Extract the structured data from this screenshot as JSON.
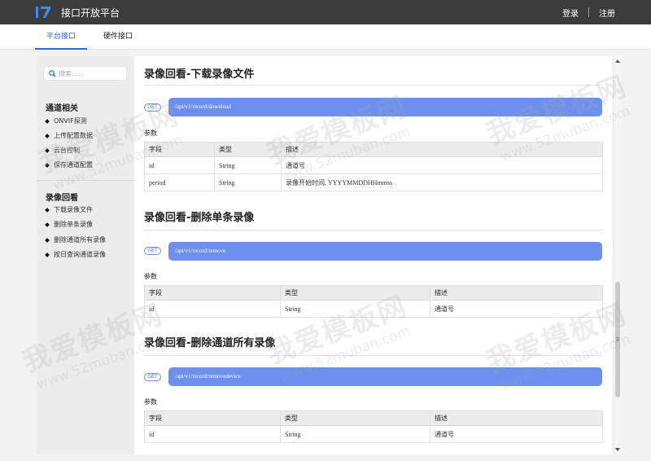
{
  "header": {
    "logo_text": "I7",
    "title": "接口开放平台",
    "login_label": "登录",
    "register_label": "注册"
  },
  "tabs": [
    {
      "label": "平台接口",
      "active": true
    },
    {
      "label": "硬件接口",
      "active": false
    }
  ],
  "sidebar": {
    "search_placeholder": "搜索……",
    "groups": [
      {
        "title": "通道相关",
        "items": [
          "ONVIF探测",
          "上传配置数据",
          "云台控制",
          "保存通道配置"
        ]
      },
      {
        "title": "录像回看",
        "items": [
          "下载录像文件",
          "删除单条录像",
          "删除通道所有录像",
          "按日查询通道录像"
        ]
      }
    ]
  },
  "sections": [
    {
      "title": "录像回看-下载录像文件",
      "method": "GET",
      "endpoint": "/api/v1/record/download",
      "params_label": "参数",
      "headers": [
        "字段",
        "类型",
        "描述"
      ],
      "rows": [
        [
          "id",
          "String",
          "通道号"
        ],
        [
          "period",
          "String",
          "录像开始时间, YYYYMMDDHHmmss"
        ]
      ]
    },
    {
      "title": "录像回看-删除单条录像",
      "method": "GET",
      "endpoint": "/api/v1/record/remove",
      "params_label": "参数",
      "headers": [
        "字段",
        "类型",
        "描述"
      ],
      "rows": [
        [
          "id",
          "String",
          "通道号"
        ]
      ]
    },
    {
      "title": "录像回看-删除通道所有录像",
      "method": "GET",
      "endpoint": "/api/v1/record/removedevice",
      "params_label": "参数",
      "headers": [
        "字段",
        "类型",
        "描述"
      ],
      "rows": [
        [
          "id",
          "String",
          "通道号"
        ]
      ]
    }
  ],
  "watermark": {
    "main": "我爱模板网",
    "sub": "www.52muban.com"
  },
  "colors": {
    "header_bg": "#3c3c3c",
    "accent": "#2b68e0",
    "endpoint_bg": "#6c8ff0",
    "logo": "#3a8ee6"
  }
}
